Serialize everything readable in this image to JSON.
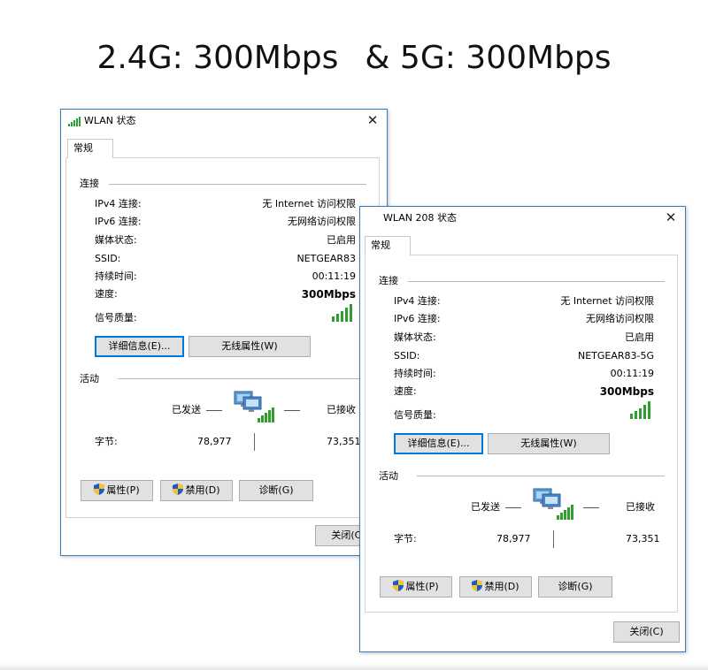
{
  "headline": {
    "part1": "2.4G: 300Mbps",
    "part2": "& 5G: 300Mbps"
  },
  "windows": [
    {
      "title": "WLAN 状态",
      "tab": "常规",
      "connection": {
        "heading": "连接",
        "rows": [
          {
            "label": "IPv4 连接:",
            "value": "无 Internet 访问权限"
          },
          {
            "label": "IPv6 连接:",
            "value": "无网络访问权限"
          },
          {
            "label": "媒体状态:",
            "value": "已启用"
          },
          {
            "label": "SSID:",
            "value": "NETGEAR83"
          },
          {
            "label": "持续时间:",
            "value": "00:11:19"
          },
          {
            "label": "速度:",
            "value": "300Mbps"
          }
        ],
        "signal_label": "信号质量:",
        "signal_level": 5,
        "details_button": "详细信息(E)...",
        "wireless_button": "无线属性(W)"
      },
      "activity": {
        "heading": "活动",
        "sent": "已发送",
        "received": "已接收",
        "bytes_label": "字节:",
        "bytes_sent": "78,977",
        "bytes_received": "73,351"
      },
      "buttons": {
        "properties": "属性(P)",
        "disable": "禁用(D)",
        "diagnose": "诊断(G)",
        "close": "关闭(C)"
      }
    },
    {
      "title": "WLAN 208 状态",
      "tab": "常规",
      "connection": {
        "heading": "连接",
        "rows": [
          {
            "label": "IPv4 连接:",
            "value": "无 Internet 访问权限"
          },
          {
            "label": "IPv6 连接:",
            "value": "无网络访问权限"
          },
          {
            "label": "媒体状态:",
            "value": "已启用"
          },
          {
            "label": "SSID:",
            "value": "NETGEAR83-5G"
          },
          {
            "label": "持续时间:",
            "value": "00:11:19"
          },
          {
            "label": "速度:",
            "value": "300Mbps"
          }
        ],
        "signal_label": "信号质量:",
        "signal_level": 5,
        "details_button": "详细信息(E)...",
        "wireless_button": "无线属性(W)"
      },
      "activity": {
        "heading": "活动",
        "sent": "已发送",
        "received": "已接收",
        "bytes_label": "字节:",
        "bytes_sent": "78,977",
        "bytes_received": "73,351"
      },
      "buttons": {
        "properties": "属性(P)",
        "disable": "禁用(D)",
        "diagnose": "诊断(G)",
        "close": "关闭(C)"
      }
    }
  ],
  "colors": {
    "window_border": "#3b7bc4",
    "signal_green": "#2e9e2e",
    "button_face": "#e1e1e1",
    "focus_border": "#0078d7"
  },
  "icons": {
    "title": "wifi-signal-icon",
    "shield": "uac-shield-icon",
    "network": "network-computers-icon",
    "close": "close-icon"
  }
}
